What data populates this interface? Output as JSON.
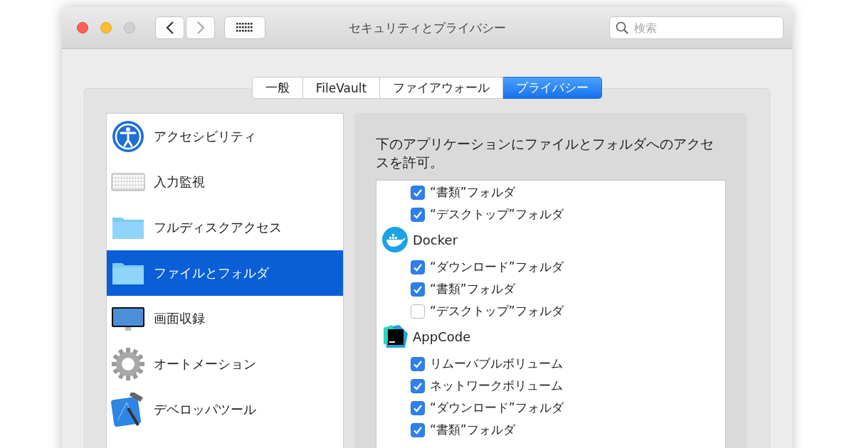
{
  "window": {
    "title": "セキュリティとプライバシー"
  },
  "search": {
    "placeholder": "検索"
  },
  "tabs": [
    {
      "label": "一般",
      "selected": false
    },
    {
      "label": "FileVault",
      "selected": false
    },
    {
      "label": "ファイアウォール",
      "selected": false
    },
    {
      "label": "プライバシー",
      "selected": true
    }
  ],
  "sidebar": {
    "items": [
      {
        "label": "アクセシビリティ",
        "selected": false
      },
      {
        "label": "入力監視",
        "selected": false
      },
      {
        "label": "フルディスクアクセス",
        "selected": false
      },
      {
        "label": "ファイルとフォルダ",
        "selected": true
      },
      {
        "label": "画面収録",
        "selected": false
      },
      {
        "label": "オートメーション",
        "selected": false
      },
      {
        "label": "デベロッパツール",
        "selected": false
      }
    ]
  },
  "description": "下のアプリケーションにファイルとフォルダへのアクセスを許可。",
  "access_list": [
    {
      "kind": "folder",
      "label": "“書類”フォルダ",
      "checked": true
    },
    {
      "kind": "folder",
      "label": "“デスクトップ”フォルダ",
      "checked": true
    },
    {
      "kind": "app",
      "label": "Docker"
    },
    {
      "kind": "folder",
      "label": "“ダウンロード”フォルダ",
      "checked": true
    },
    {
      "kind": "folder",
      "label": "“書類”フォルダ",
      "checked": true
    },
    {
      "kind": "folder",
      "label": "“デスクトップ”フォルダ",
      "checked": false
    },
    {
      "kind": "app",
      "label": "AppCode"
    },
    {
      "kind": "folder",
      "label": "リムーバブルボリューム",
      "checked": true
    },
    {
      "kind": "folder",
      "label": "ネットワークボリューム",
      "checked": true
    },
    {
      "kind": "folder",
      "label": "“ダウンロード”フォルダ",
      "checked": true
    },
    {
      "kind": "folder",
      "label": "“書類”フォルダ",
      "checked": true
    }
  ]
}
